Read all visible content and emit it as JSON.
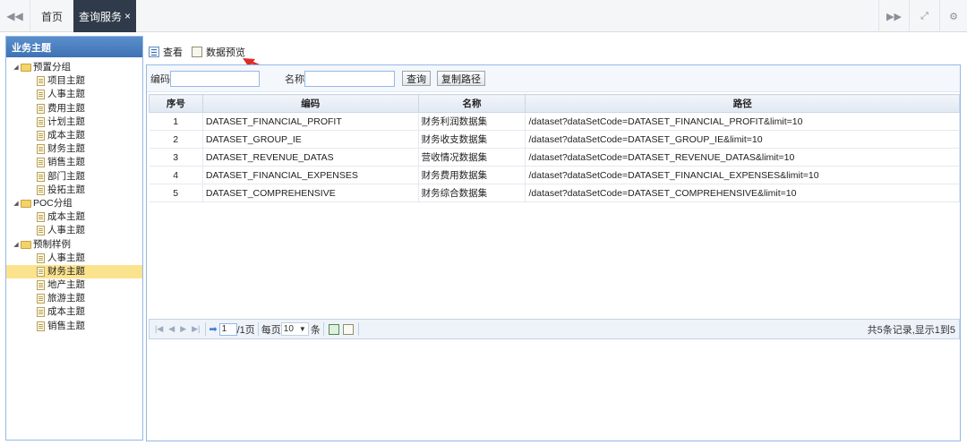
{
  "topbar": {
    "nav_prev_icon": "double-left-icon",
    "tabs": [
      {
        "label": "首页"
      },
      {
        "label": "查询服务",
        "close": "×"
      }
    ],
    "right_icons": [
      "double-right-icon",
      "fullscreen-icon",
      "gear-icon"
    ]
  },
  "sidebar": {
    "title": "业务主题",
    "tree": [
      {
        "label": "预置分组",
        "type": "group"
      },
      {
        "label": "项目主题",
        "type": "item"
      },
      {
        "label": "人事主题",
        "type": "item"
      },
      {
        "label": "费用主题",
        "type": "item"
      },
      {
        "label": "计划主题",
        "type": "item"
      },
      {
        "label": "成本主题",
        "type": "item"
      },
      {
        "label": "财务主题",
        "type": "item"
      },
      {
        "label": "销售主题",
        "type": "item"
      },
      {
        "label": "部门主题",
        "type": "item"
      },
      {
        "label": "投拓主题",
        "type": "item"
      },
      {
        "label": "POC分组",
        "type": "group"
      },
      {
        "label": "成本主题",
        "type": "item"
      },
      {
        "label": "人事主题",
        "type": "item"
      },
      {
        "label": "预制样例",
        "type": "group"
      },
      {
        "label": "人事主题",
        "type": "item"
      },
      {
        "label": "财务主题",
        "type": "item",
        "selected": true
      },
      {
        "label": "地产主题",
        "type": "item"
      },
      {
        "label": "旅游主题",
        "type": "item"
      },
      {
        "label": "成本主题",
        "type": "item"
      },
      {
        "label": "销售主题",
        "type": "item"
      }
    ]
  },
  "toolbar": {
    "view_label": "查看",
    "preview_label": "数据预览"
  },
  "search": {
    "code_label": "编码",
    "code_value": "",
    "name_label": "名称",
    "name_value": "",
    "query_button": "查询",
    "copy_button": "复制路径"
  },
  "grid": {
    "columns": [
      "序号",
      "编码",
      "名称",
      "路径"
    ],
    "rows": [
      {
        "no": "1",
        "code": "DATASET_FINANCIAL_PROFIT",
        "name": "财务利润数据集",
        "path": "/dataset?dataSetCode=DATASET_FINANCIAL_PROFIT&limit=10"
      },
      {
        "no": "2",
        "code": "DATASET_GROUP_IE",
        "name": "财务收支数据集",
        "path": "/dataset?dataSetCode=DATASET_GROUP_IE&limit=10"
      },
      {
        "no": "3",
        "code": "DATASET_REVENUE_DATAS",
        "name": "营收情况数据集",
        "path": "/dataset?dataSetCode=DATASET_REVENUE_DATAS&limit=10"
      },
      {
        "no": "4",
        "code": "DATASET_FINANCIAL_EXPENSES",
        "name": "财务费用数据集",
        "path": "/dataset?dataSetCode=DATASET_FINANCIAL_EXPENSES&limit=10"
      },
      {
        "no": "5",
        "code": "DATASET_COMPREHENSIVE",
        "name": "财务综合数据集",
        "path": "/dataset?dataSetCode=DATASET_COMPREHENSIVE&limit=10"
      }
    ]
  },
  "pager": {
    "page_value": "1",
    "total_pages": "/1页",
    "per_page_label": "每页",
    "per_page_value": "10",
    "per_page_unit": "条",
    "info": "共5条记录,显示1到5"
  },
  "colors": {
    "accent": "#95b8e7",
    "header_blue": "#3e72b3",
    "active_tab": "#2f3b4a",
    "selected_row": "#fbe38e",
    "arrow_red": "#e02b2b"
  }
}
